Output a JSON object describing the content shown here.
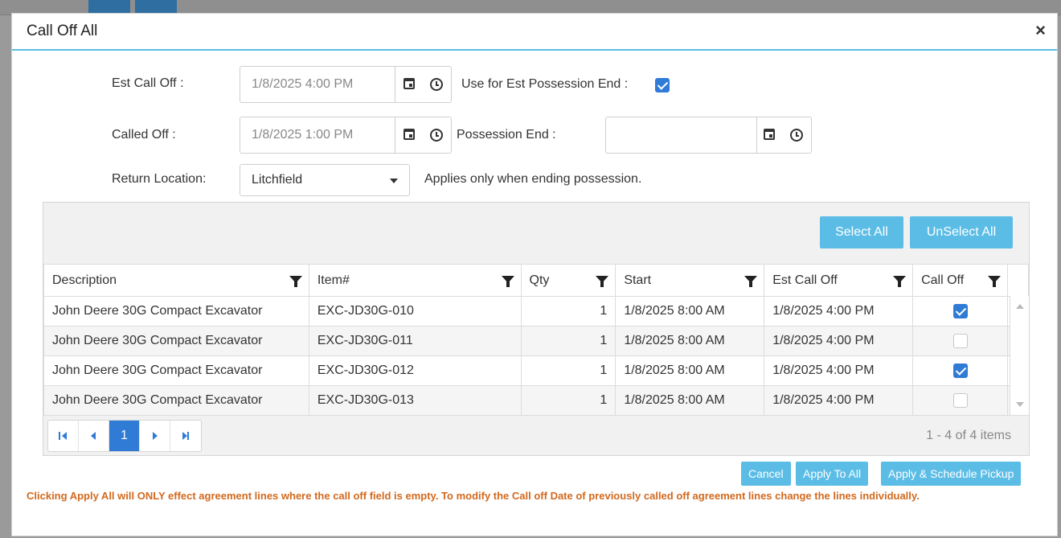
{
  "dialog": {
    "title": "Call Off All",
    "close_label": "×"
  },
  "form": {
    "est_call_off_label": "Est Call Off :",
    "est_call_off_value": "1/8/2025 4:00 PM",
    "use_for_est_label": "Use for Est Possession End :",
    "use_for_est_checked": true,
    "called_off_label": "Called Off :",
    "called_off_value": "1/8/2025 1:00 PM",
    "possession_end_label": "Possession End :",
    "possession_end_value": "",
    "return_location_label": "Return Location:",
    "return_location_value": "Litchfield",
    "return_location_note": "Applies only when ending possession."
  },
  "grid": {
    "select_all_label": "Select All",
    "unselect_all_label": "UnSelect All",
    "columns": [
      "Description",
      "Item#",
      "Qty",
      "Start",
      "Est Call Off",
      "Call Off"
    ],
    "rows": [
      {
        "description": "John Deere 30G Compact Excavator",
        "item": "EXC-JD30G-010",
        "qty": "1",
        "start": "1/8/2025 8:00 AM",
        "est_call_off": "1/8/2025 4:00 PM",
        "call_off": true
      },
      {
        "description": "John Deere 30G Compact Excavator",
        "item": "EXC-JD30G-011",
        "qty": "1",
        "start": "1/8/2025 8:00 AM",
        "est_call_off": "1/8/2025 4:00 PM",
        "call_off": false
      },
      {
        "description": "John Deere 30G Compact Excavator",
        "item": "EXC-JD30G-012",
        "qty": "1",
        "start": "1/8/2025 8:00 AM",
        "est_call_off": "1/8/2025 4:00 PM",
        "call_off": true
      },
      {
        "description": "John Deere 30G Compact Excavator",
        "item": "EXC-JD30G-013",
        "qty": "1",
        "start": "1/8/2025 8:00 AM",
        "est_call_off": "1/8/2025 4:00 PM",
        "call_off": false
      }
    ],
    "pager": {
      "current_page": "1",
      "info": "1 - 4 of 4 items"
    }
  },
  "footer": {
    "cancel_label": "Cancel",
    "apply_all_label": "Apply To All",
    "apply_schedule_label": "Apply & Schedule Pickup",
    "warning": "Clicking Apply All will ONLY effect agreement lines where the call off field is empty. To modify the Call off Date of previously called off agreement lines change the lines individually."
  },
  "colors": {
    "accent": "#5bbde6",
    "primary": "#2f7bd6",
    "warning": "#d2691e"
  }
}
